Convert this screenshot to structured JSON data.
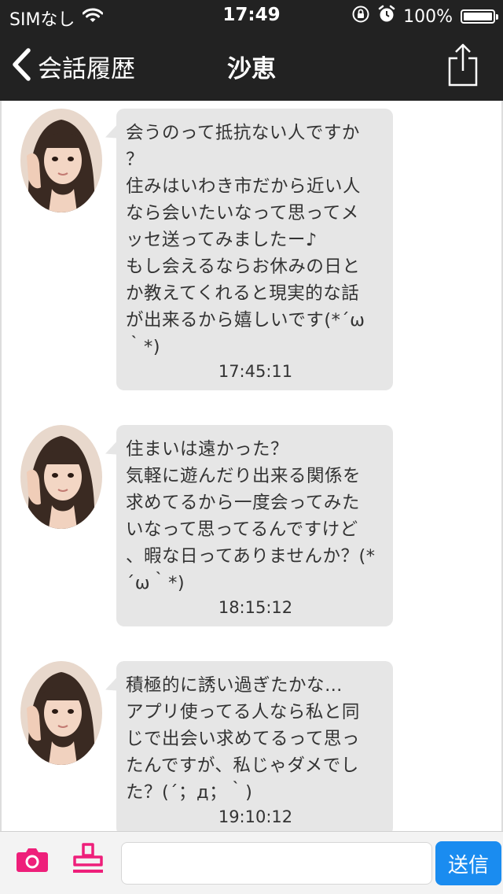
{
  "status_bar": {
    "carrier": "SIMなし",
    "time": "17:49",
    "battery_text": "100%",
    "icons": [
      "wifi-icon",
      "rotation-lock-icon",
      "alarm-icon",
      "battery-icon"
    ]
  },
  "nav": {
    "back_label": "会話履歴",
    "title": "沙恵",
    "share_icon": "share-icon",
    "back_icon": "chevron-left-icon"
  },
  "messages": [
    {
      "sender": "沙恵",
      "text": "会うのって抵抗ない人ですか\n？\n住みはいわき市だから近い人\nなら会いたいなって思ってメ\nッセ送ってみましたー♪\nもし会えるならお休みの日と\nか教えてくれると現実的な話\nが出来るから嬉しいです(*´ω\n｀*)",
      "time": "17:45:11"
    },
    {
      "sender": "沙恵",
      "text": "住まいは遠かった？\n気軽に遊んだり出来る関係を\n求めてるから一度会ってみた\nいなって思ってるんですけど\n、暇な日ってありませんか？(*\n´ω｀*)",
      "time": "18:15:12"
    },
    {
      "sender": "沙恵",
      "text": "積極的に誘い過ぎたかな…\nアプリ使ってる人なら私と同\nじで出会い求めてるって思っ\nたんですが、私じゃダメでし\nた？(´；д；｀)",
      "time": "19:10:12"
    }
  ],
  "input": {
    "placeholder": "",
    "send_label": "送信",
    "camera_icon": "camera-icon",
    "stamp_icon": "stamp-icon"
  },
  "colors": {
    "nav_bg": "#222222",
    "bubble_bg": "#e6e6e6",
    "accent_pink": "#ee1f7a",
    "send_blue": "#1a8cf0"
  }
}
